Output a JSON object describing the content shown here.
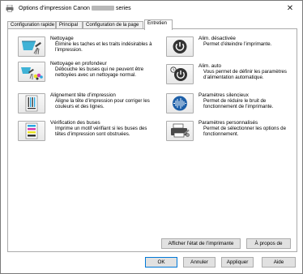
{
  "window": {
    "title_prefix": "Options d’impression Canon",
    "title_suffix": "series",
    "close_glyph": "✕"
  },
  "tabs": [
    {
      "label": "Configuration rapide"
    },
    {
      "label": "Principal"
    },
    {
      "label": "Configuration de la page"
    },
    {
      "label": "Entretien"
    }
  ],
  "active_tab": "Entretien",
  "maintenance": {
    "left": [
      {
        "title": "Nettoyage",
        "desc": "Élimine les taches et les traits indésirables à l’impression.",
        "icon": "cleaning-icon"
      },
      {
        "title": "Nettoyage en profondeur",
        "desc": "Débouche les buses qui ne peuvent être nettoyées avec un nettoyage normal.",
        "icon": "deep-cleaning-icon"
      },
      {
        "title": "Alignement tête d’impression",
        "desc": "Aligne la tête d’impression pour corriger les couleurs et des lignes.",
        "icon": "head-alignment-icon"
      },
      {
        "title": "Vérification des buses",
        "desc": "Imprime un motif vérifiant si les buses des têtes d’impression sont obstruées.",
        "icon": "nozzle-check-icon"
      }
    ],
    "right": [
      {
        "title": "Alim. désactivée",
        "desc": "Permet d’éteindre l’imprimante.",
        "icon": "power-off-icon"
      },
      {
        "title": "Alim. auto",
        "desc": "Vous permet de définir les paramètres d’alimentation automatique.",
        "icon": "auto-power-icon"
      },
      {
        "title": "Paramètres silencieux",
        "desc": "Permet de réduire le bruit de fonctionnement de l’imprimante.",
        "icon": "quiet-settings-icon"
      },
      {
        "title": "Paramètres personnalisés",
        "desc": "Permet de sélectionner les options de fonctionnement.",
        "icon": "custom-settings-icon"
      }
    ]
  },
  "panel_buttons": {
    "status": "Afficher l’état de l’imprimante",
    "about": "À propos de"
  },
  "dialog_buttons": {
    "ok": "OK",
    "cancel": "Annuler",
    "apply": "Appliquer",
    "help": "Aide"
  },
  "colors": {
    "ok_border": "#0078d7",
    "button_face": "#e1e1e1"
  }
}
